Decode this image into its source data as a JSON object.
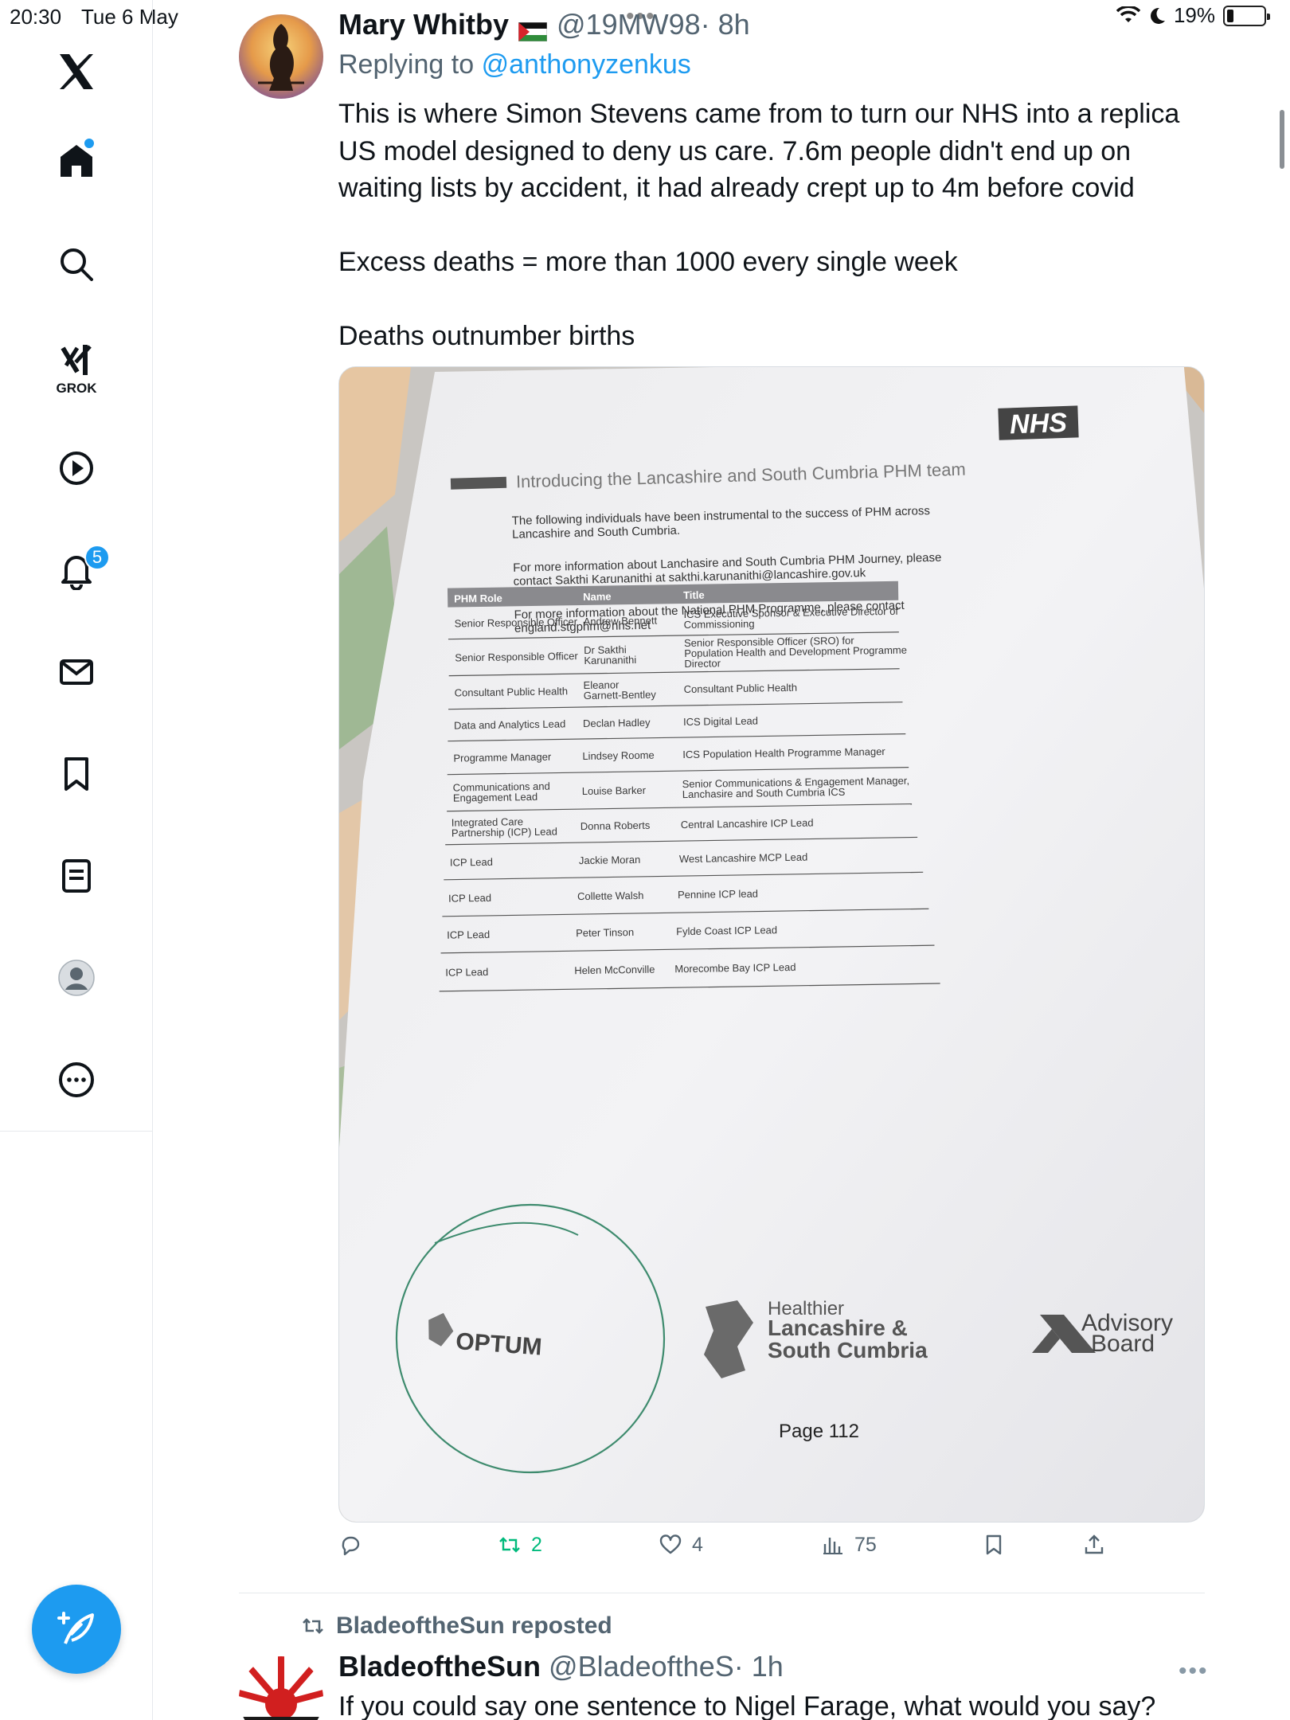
{
  "status_bar": {
    "time": "20:30",
    "date": "Tue 6 May",
    "battery": "19%",
    "battery_level": 0.19
  },
  "sidebar": {
    "grok_label": "GROK",
    "notifications_badge": "5"
  },
  "tweet": {
    "author_name": "Mary Whitby",
    "author_handle": "@19MW98",
    "time": "· 8h",
    "replying_prefix": "Replying to",
    "replying_to": "@anthonyzenkus",
    "text": "This is where Simon Stevens came from to turn our NHS into a replica US model designed to deny us care. 7.6m people didn't end up on waiting lists by accident, it had already crept up to 4m before covid\n\nExcess deaths = more than 1000 every single week\n\nDeaths outnumber births",
    "actions": {
      "reply_count": "",
      "repost_count": "2",
      "like_count": "4",
      "views_count": "75"
    }
  },
  "document": {
    "nhs_logo": "NHS",
    "title": "Introducing the Lancashire and South Cumbria PHM team",
    "para1": "The following individuals have been instrumental to the success of PHM across Lancashire and South Cumbria.",
    "para2": "For more information about Lanchasire and South Cumbria PHM Journey, please contact Sakthi Karunanithi at sakthi.karunanithi@lancashire.gov.uk",
    "para3": "For more information about the National PHM Programme, please contact england.stgphm@nhs.net",
    "table": {
      "headers": [
        "PHM Role",
        "Name",
        "Title"
      ],
      "rows": [
        [
          "Senior Responsible Officer",
          "Andrew Bennett",
          "ICS Executive Sponsor & Executive Director of Commissioning"
        ],
        [
          "Senior Responsible Officer",
          "Dr Sakthi Karunanithi",
          "Senior Responsible Officer (SRO) for Population Health and Development Programme Director"
        ],
        [
          "Consultant Public Health",
          "Eleanor Garnett-Bentley",
          "Consultant Public Health"
        ],
        [
          "Data and Analytics Lead",
          "Declan Hadley",
          "ICS Digital Lead"
        ],
        [
          "Programme Manager",
          "Lindsey Roome",
          "ICS Population Health Programme Manager"
        ],
        [
          "Communications and Engagement Lead",
          "Louise Barker",
          "Senior Communications & Engagement Manager, Lanchasire and South Cumbria ICS"
        ],
        [
          "Integrated Care Partnership (ICP) Lead",
          "Donna Roberts",
          "Central Lancashire ICP Lead"
        ],
        [
          "ICP Lead",
          "Jackie Moran",
          "West Lancashire MCP Lead"
        ],
        [
          "ICP Lead",
          "Collette Walsh",
          "Pennine ICP lead"
        ],
        [
          "ICP Lead",
          "Peter Tinson",
          "Fylde Coast ICP Lead"
        ],
        [
          "ICP Lead",
          "Helen McConville",
          "Morecombe Bay ICP Lead"
        ]
      ]
    },
    "logo_optum": "OPTUM",
    "logo_healthier_1": "Healthier",
    "logo_healthier_2": "Lancashire &",
    "logo_healthier_3": "South Cumbria",
    "logo_advisory_1": "Advisory",
    "logo_advisory_2": "Board",
    "page": "Page 112"
  },
  "next_tweet": {
    "reposted_by": "BladeoftheSun reposted",
    "author_name": "BladeoftheSun",
    "author_handle": "@BladeoftheS",
    "time": "· 1h",
    "text": "If you could say one sentence to Nigel Farage, what would you say?"
  },
  "colors": {
    "accent": "#1d9bf0",
    "repost_green": "#00ba7c",
    "secondary_text": "#536471"
  }
}
